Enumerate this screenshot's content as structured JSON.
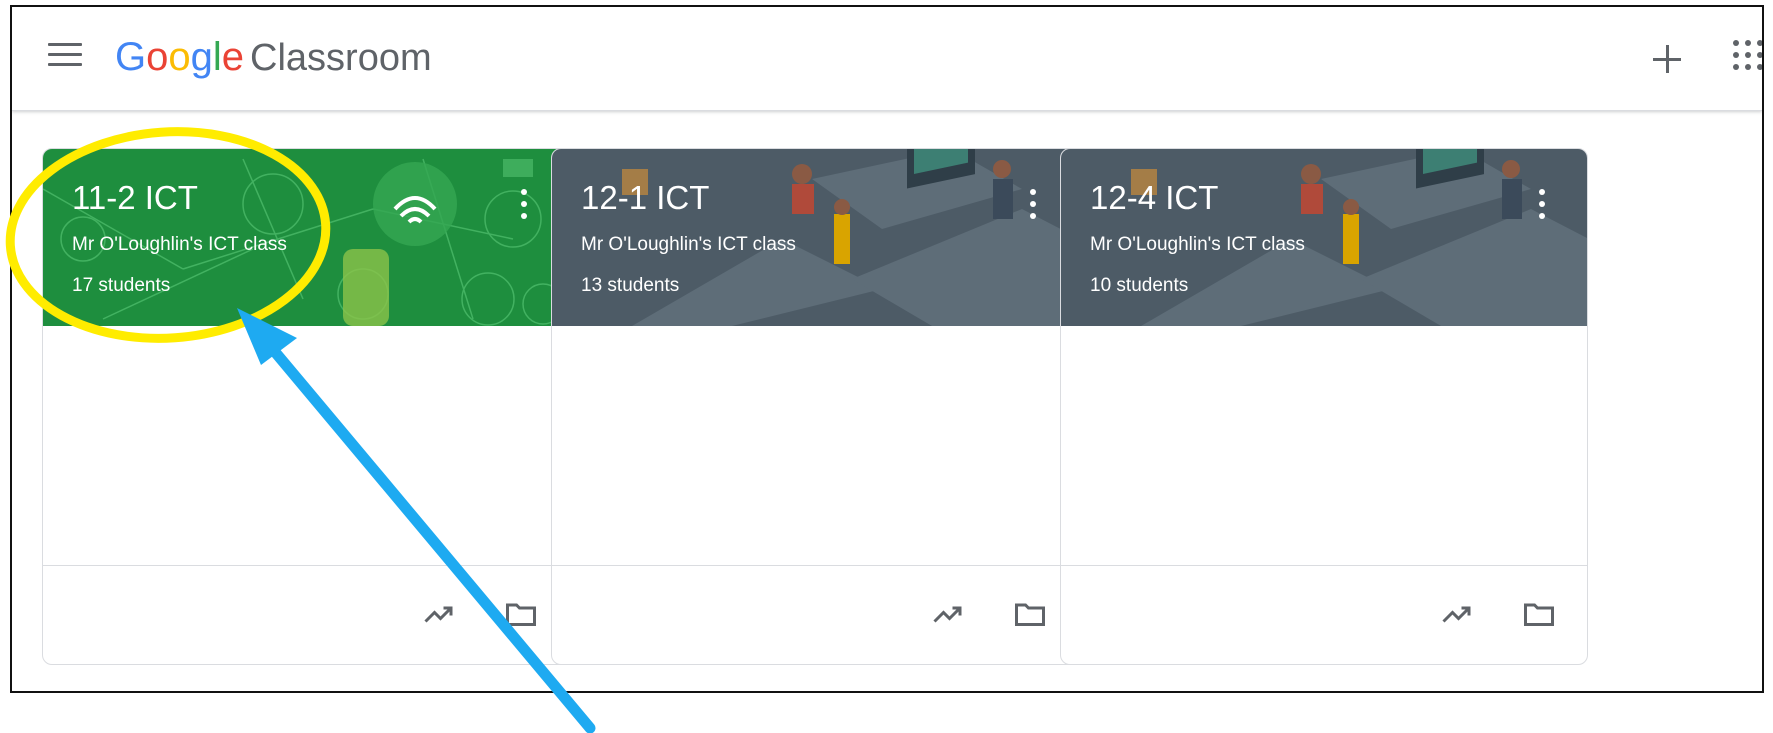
{
  "header": {
    "brand_letters": [
      {
        "char": "G",
        "color": "#4285F4"
      },
      {
        "char": "o",
        "color": "#EA4335"
      },
      {
        "char": "o",
        "color": "#FBBC05"
      },
      {
        "char": "g",
        "color": "#4285F4"
      },
      {
        "char": "l",
        "color": "#34A853"
      },
      {
        "char": "e",
        "color": "#EA4335"
      }
    ],
    "product": "Classroom",
    "icons": [
      "menu-icon",
      "plus-icon",
      "apps-icon"
    ]
  },
  "classes": [
    {
      "title": "11-2 ICT",
      "teacher": "Mr O'Loughlin's ICT class",
      "students": "17 students",
      "theme_color": "#1e8e3e"
    },
    {
      "title": "12-1 ICT",
      "teacher": "Mr O'Loughlin's ICT class",
      "students": "13 students",
      "theme_color": "#4d5b66"
    },
    {
      "title": "12-4 ICT",
      "teacher": "Mr O'Loughlin's ICT class",
      "students": "10 students",
      "theme_color": "#4d5b66"
    }
  ],
  "card_icons": [
    "more-vert-icon",
    "trending-icon",
    "folder-icon"
  ],
  "annotation": {
    "highlight_color": "#ffec00",
    "arrow_color": "#1eaaf1"
  }
}
